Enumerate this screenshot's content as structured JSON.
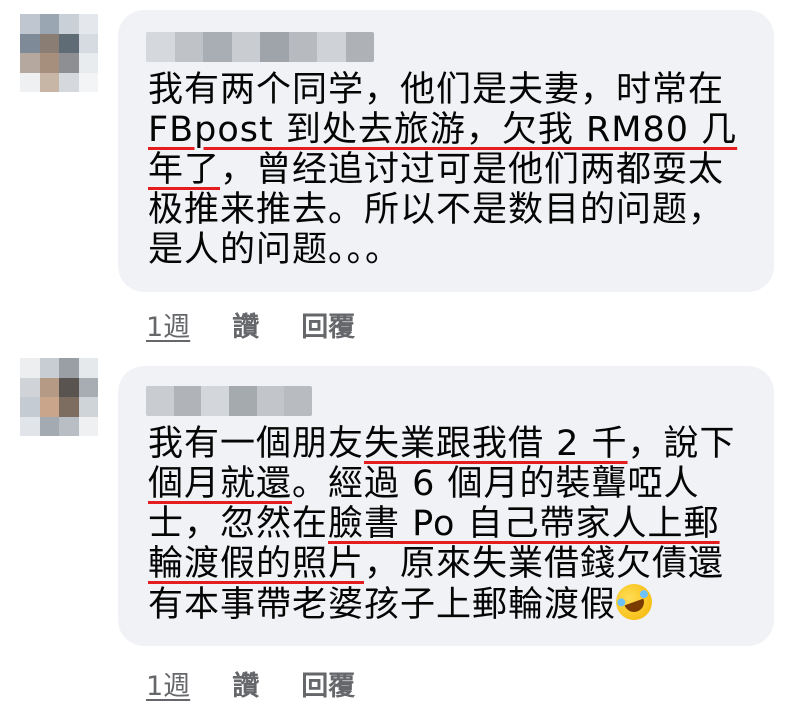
{
  "comments": [
    {
      "lines": [
        [
          {
            "t": "我有两个同学，他们是夫妻，时常在",
            "u": false
          }
        ],
        [
          {
            "t": "FBpost 到处去旅游，欠我 RM80 几",
            "u": true
          }
        ],
        [
          {
            "t": "年了",
            "u": true
          },
          {
            "t": "，曾经追讨过可是他们两都耍太",
            "u": false
          }
        ],
        [
          {
            "t": "极推来推去。所以不是数目的问题，",
            "u": false
          }
        ],
        [
          {
            "t": "是人的问题。。。",
            "u": false
          }
        ]
      ],
      "actions": {
        "time": "1週",
        "like": "讚",
        "reply": "回覆"
      }
    },
    {
      "lines": [
        [
          {
            "t": "我有一個朋友",
            "u": false
          },
          {
            "t": "失業跟我借 2 千",
            "u": true
          },
          {
            "t": "，說下",
            "u": false
          }
        ],
        [
          {
            "t": "個月就還",
            "u": true
          },
          {
            "t": "。經過 6 個月的裝聾啞人",
            "u": false
          }
        ],
        [
          {
            "t": "士，忽然在",
            "u": false
          },
          {
            "t": "臉書 Po 自己帶家人上郵",
            "u": true
          }
        ],
        [
          {
            "t": "輪渡假的照片",
            "u": true
          },
          {
            "t": "，原來失業借錢欠債還",
            "u": false
          }
        ],
        [
          {
            "t": "有本事帶老婆孩子上郵輪渡假",
            "u": false
          }
        ]
      ],
      "actions": {
        "time": "1週",
        "like": "讚",
        "reply": "回覆"
      }
    }
  ],
  "icons": {
    "emoji": "rolling-on-floor-laughing-emoji"
  },
  "colors": {
    "bubble": "#f0f2f5",
    "text": "#050505",
    "meta": "#65676b",
    "underline": "#e41e1e"
  }
}
